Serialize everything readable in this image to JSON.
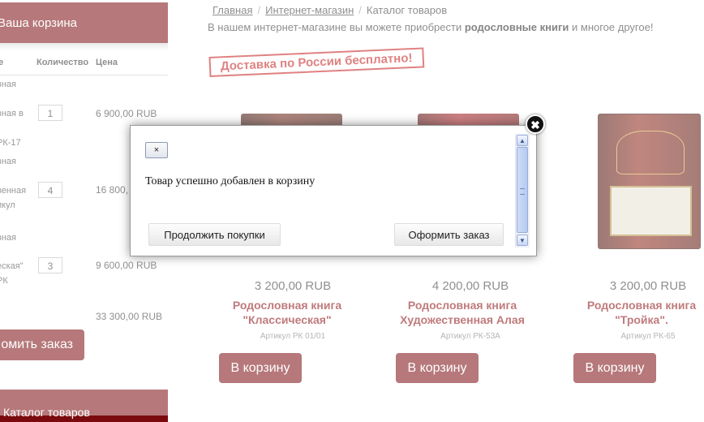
{
  "cart": {
    "title": "Ваша корзина",
    "col_name": "е",
    "col_qty": "Количество",
    "col_price": "Цена",
    "items": [
      {
        "line1": "вная",
        "line2": "вная в",
        "line3": "РК-17",
        "qty": "1",
        "price": "6 900,00 RUB"
      },
      {
        "line1": "вная",
        "line2": "венная",
        "line3": "икул",
        "qty": "4",
        "price": "16 800,"
      },
      {
        "line1": "вная",
        "line2": "еская\"",
        "line3": "РК",
        "qty": "3",
        "price": "9 600,00 RUB"
      }
    ],
    "total": "33 300,00 RUB",
    "checkout_label": "омить заказ"
  },
  "catalog": {
    "title": "Каталог товаров"
  },
  "breadcrumb": {
    "home": "Главная",
    "shop": "Интернет-магазин",
    "current": "Каталог товаров"
  },
  "intro": {
    "before": "В нашем интернет-магазине вы можете приобрести ",
    "bold": "родословные книги",
    "after": " и многое другое!"
  },
  "delivery_banner": "Доставка по России бесплатно!",
  "products": [
    {
      "price": "3 200,00 RUB",
      "name1": "Родословная книга",
      "name2": "\"Классическая\"",
      "sku": "Артикул РК 01/01",
      "button": "В корзину"
    },
    {
      "price": "4 200,00 RUB",
      "name1": "Родословная книга",
      "name2": "Художественная Алая",
      "sku": "Артикул РК-53А",
      "button": "В корзину"
    },
    {
      "price": "3 200,00 RUB",
      "name1": "Родословная книга",
      "name2": "\"Тройка\".",
      "sku": "Артикул РК-65",
      "button": "В корзину"
    }
  ],
  "modal": {
    "close_small": "×",
    "message": "Товар успешно добавлен в корзину",
    "continue_label": "Продолжить покупки",
    "order_label": "Оформить заказ",
    "close_circle": "✖"
  }
}
